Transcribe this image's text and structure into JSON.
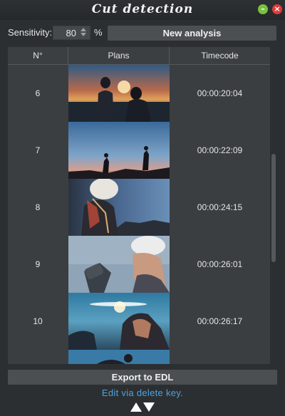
{
  "window": {
    "title": "Cut detection"
  },
  "toolbar": {
    "sensitivity_label": "Sensitivity:",
    "sensitivity_value": "80",
    "unit": "%",
    "new_analysis_label": "New analysis"
  },
  "table": {
    "headers": [
      "N°",
      "Plans",
      "Timecode"
    ],
    "rows": [
      {
        "n": "6",
        "timecode": "00:00:20:04"
      },
      {
        "n": "7",
        "timecode": "00:00:22:09"
      },
      {
        "n": "8",
        "timecode": "00:00:24:15"
      },
      {
        "n": "9",
        "timecode": "00:00:26:01"
      },
      {
        "n": "10",
        "timecode": "00:00:26:17"
      }
    ]
  },
  "footer": {
    "export_label": "Export to EDL",
    "hint": "Edit via delete key."
  },
  "colors": {
    "accent": "#4aa3e8",
    "minimize": "#7ac142",
    "close": "#e23a3a"
  },
  "icons": {
    "minimize": "minimize-icon",
    "close": "close-icon",
    "nav": [
      "arrow-up-icon",
      "arrow-down-icon"
    ]
  }
}
